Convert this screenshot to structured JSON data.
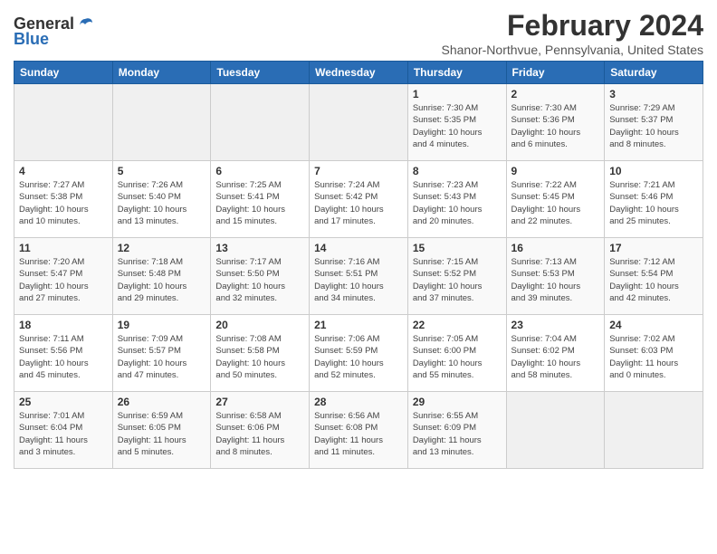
{
  "logo": {
    "general": "General",
    "blue": "Blue"
  },
  "title": {
    "month_year": "February 2024",
    "location": "Shanor-Northvue, Pennsylvania, United States"
  },
  "headers": [
    "Sunday",
    "Monday",
    "Tuesday",
    "Wednesday",
    "Thursday",
    "Friday",
    "Saturday"
  ],
  "weeks": [
    [
      {
        "day": "",
        "info": ""
      },
      {
        "day": "",
        "info": ""
      },
      {
        "day": "",
        "info": ""
      },
      {
        "day": "",
        "info": ""
      },
      {
        "day": "1",
        "info": "Sunrise: 7:30 AM\nSunset: 5:35 PM\nDaylight: 10 hours\nand 4 minutes."
      },
      {
        "day": "2",
        "info": "Sunrise: 7:30 AM\nSunset: 5:36 PM\nDaylight: 10 hours\nand 6 minutes."
      },
      {
        "day": "3",
        "info": "Sunrise: 7:29 AM\nSunset: 5:37 PM\nDaylight: 10 hours\nand 8 minutes."
      }
    ],
    [
      {
        "day": "4",
        "info": "Sunrise: 7:27 AM\nSunset: 5:38 PM\nDaylight: 10 hours\nand 10 minutes."
      },
      {
        "day": "5",
        "info": "Sunrise: 7:26 AM\nSunset: 5:40 PM\nDaylight: 10 hours\nand 13 minutes."
      },
      {
        "day": "6",
        "info": "Sunrise: 7:25 AM\nSunset: 5:41 PM\nDaylight: 10 hours\nand 15 minutes."
      },
      {
        "day": "7",
        "info": "Sunrise: 7:24 AM\nSunset: 5:42 PM\nDaylight: 10 hours\nand 17 minutes."
      },
      {
        "day": "8",
        "info": "Sunrise: 7:23 AM\nSunset: 5:43 PM\nDaylight: 10 hours\nand 20 minutes."
      },
      {
        "day": "9",
        "info": "Sunrise: 7:22 AM\nSunset: 5:45 PM\nDaylight: 10 hours\nand 22 minutes."
      },
      {
        "day": "10",
        "info": "Sunrise: 7:21 AM\nSunset: 5:46 PM\nDaylight: 10 hours\nand 25 minutes."
      }
    ],
    [
      {
        "day": "11",
        "info": "Sunrise: 7:20 AM\nSunset: 5:47 PM\nDaylight: 10 hours\nand 27 minutes."
      },
      {
        "day": "12",
        "info": "Sunrise: 7:18 AM\nSunset: 5:48 PM\nDaylight: 10 hours\nand 29 minutes."
      },
      {
        "day": "13",
        "info": "Sunrise: 7:17 AM\nSunset: 5:50 PM\nDaylight: 10 hours\nand 32 minutes."
      },
      {
        "day": "14",
        "info": "Sunrise: 7:16 AM\nSunset: 5:51 PM\nDaylight: 10 hours\nand 34 minutes."
      },
      {
        "day": "15",
        "info": "Sunrise: 7:15 AM\nSunset: 5:52 PM\nDaylight: 10 hours\nand 37 minutes."
      },
      {
        "day": "16",
        "info": "Sunrise: 7:13 AM\nSunset: 5:53 PM\nDaylight: 10 hours\nand 39 minutes."
      },
      {
        "day": "17",
        "info": "Sunrise: 7:12 AM\nSunset: 5:54 PM\nDaylight: 10 hours\nand 42 minutes."
      }
    ],
    [
      {
        "day": "18",
        "info": "Sunrise: 7:11 AM\nSunset: 5:56 PM\nDaylight: 10 hours\nand 45 minutes."
      },
      {
        "day": "19",
        "info": "Sunrise: 7:09 AM\nSunset: 5:57 PM\nDaylight: 10 hours\nand 47 minutes."
      },
      {
        "day": "20",
        "info": "Sunrise: 7:08 AM\nSunset: 5:58 PM\nDaylight: 10 hours\nand 50 minutes."
      },
      {
        "day": "21",
        "info": "Sunrise: 7:06 AM\nSunset: 5:59 PM\nDaylight: 10 hours\nand 52 minutes."
      },
      {
        "day": "22",
        "info": "Sunrise: 7:05 AM\nSunset: 6:00 PM\nDaylight: 10 hours\nand 55 minutes."
      },
      {
        "day": "23",
        "info": "Sunrise: 7:04 AM\nSunset: 6:02 PM\nDaylight: 10 hours\nand 58 minutes."
      },
      {
        "day": "24",
        "info": "Sunrise: 7:02 AM\nSunset: 6:03 PM\nDaylight: 11 hours\nand 0 minutes."
      }
    ],
    [
      {
        "day": "25",
        "info": "Sunrise: 7:01 AM\nSunset: 6:04 PM\nDaylight: 11 hours\nand 3 minutes."
      },
      {
        "day": "26",
        "info": "Sunrise: 6:59 AM\nSunset: 6:05 PM\nDaylight: 11 hours\nand 5 minutes."
      },
      {
        "day": "27",
        "info": "Sunrise: 6:58 AM\nSunset: 6:06 PM\nDaylight: 11 hours\nand 8 minutes."
      },
      {
        "day": "28",
        "info": "Sunrise: 6:56 AM\nSunset: 6:08 PM\nDaylight: 11 hours\nand 11 minutes."
      },
      {
        "day": "29",
        "info": "Sunrise: 6:55 AM\nSunset: 6:09 PM\nDaylight: 11 hours\nand 13 minutes."
      },
      {
        "day": "",
        "info": ""
      },
      {
        "day": "",
        "info": ""
      }
    ]
  ]
}
